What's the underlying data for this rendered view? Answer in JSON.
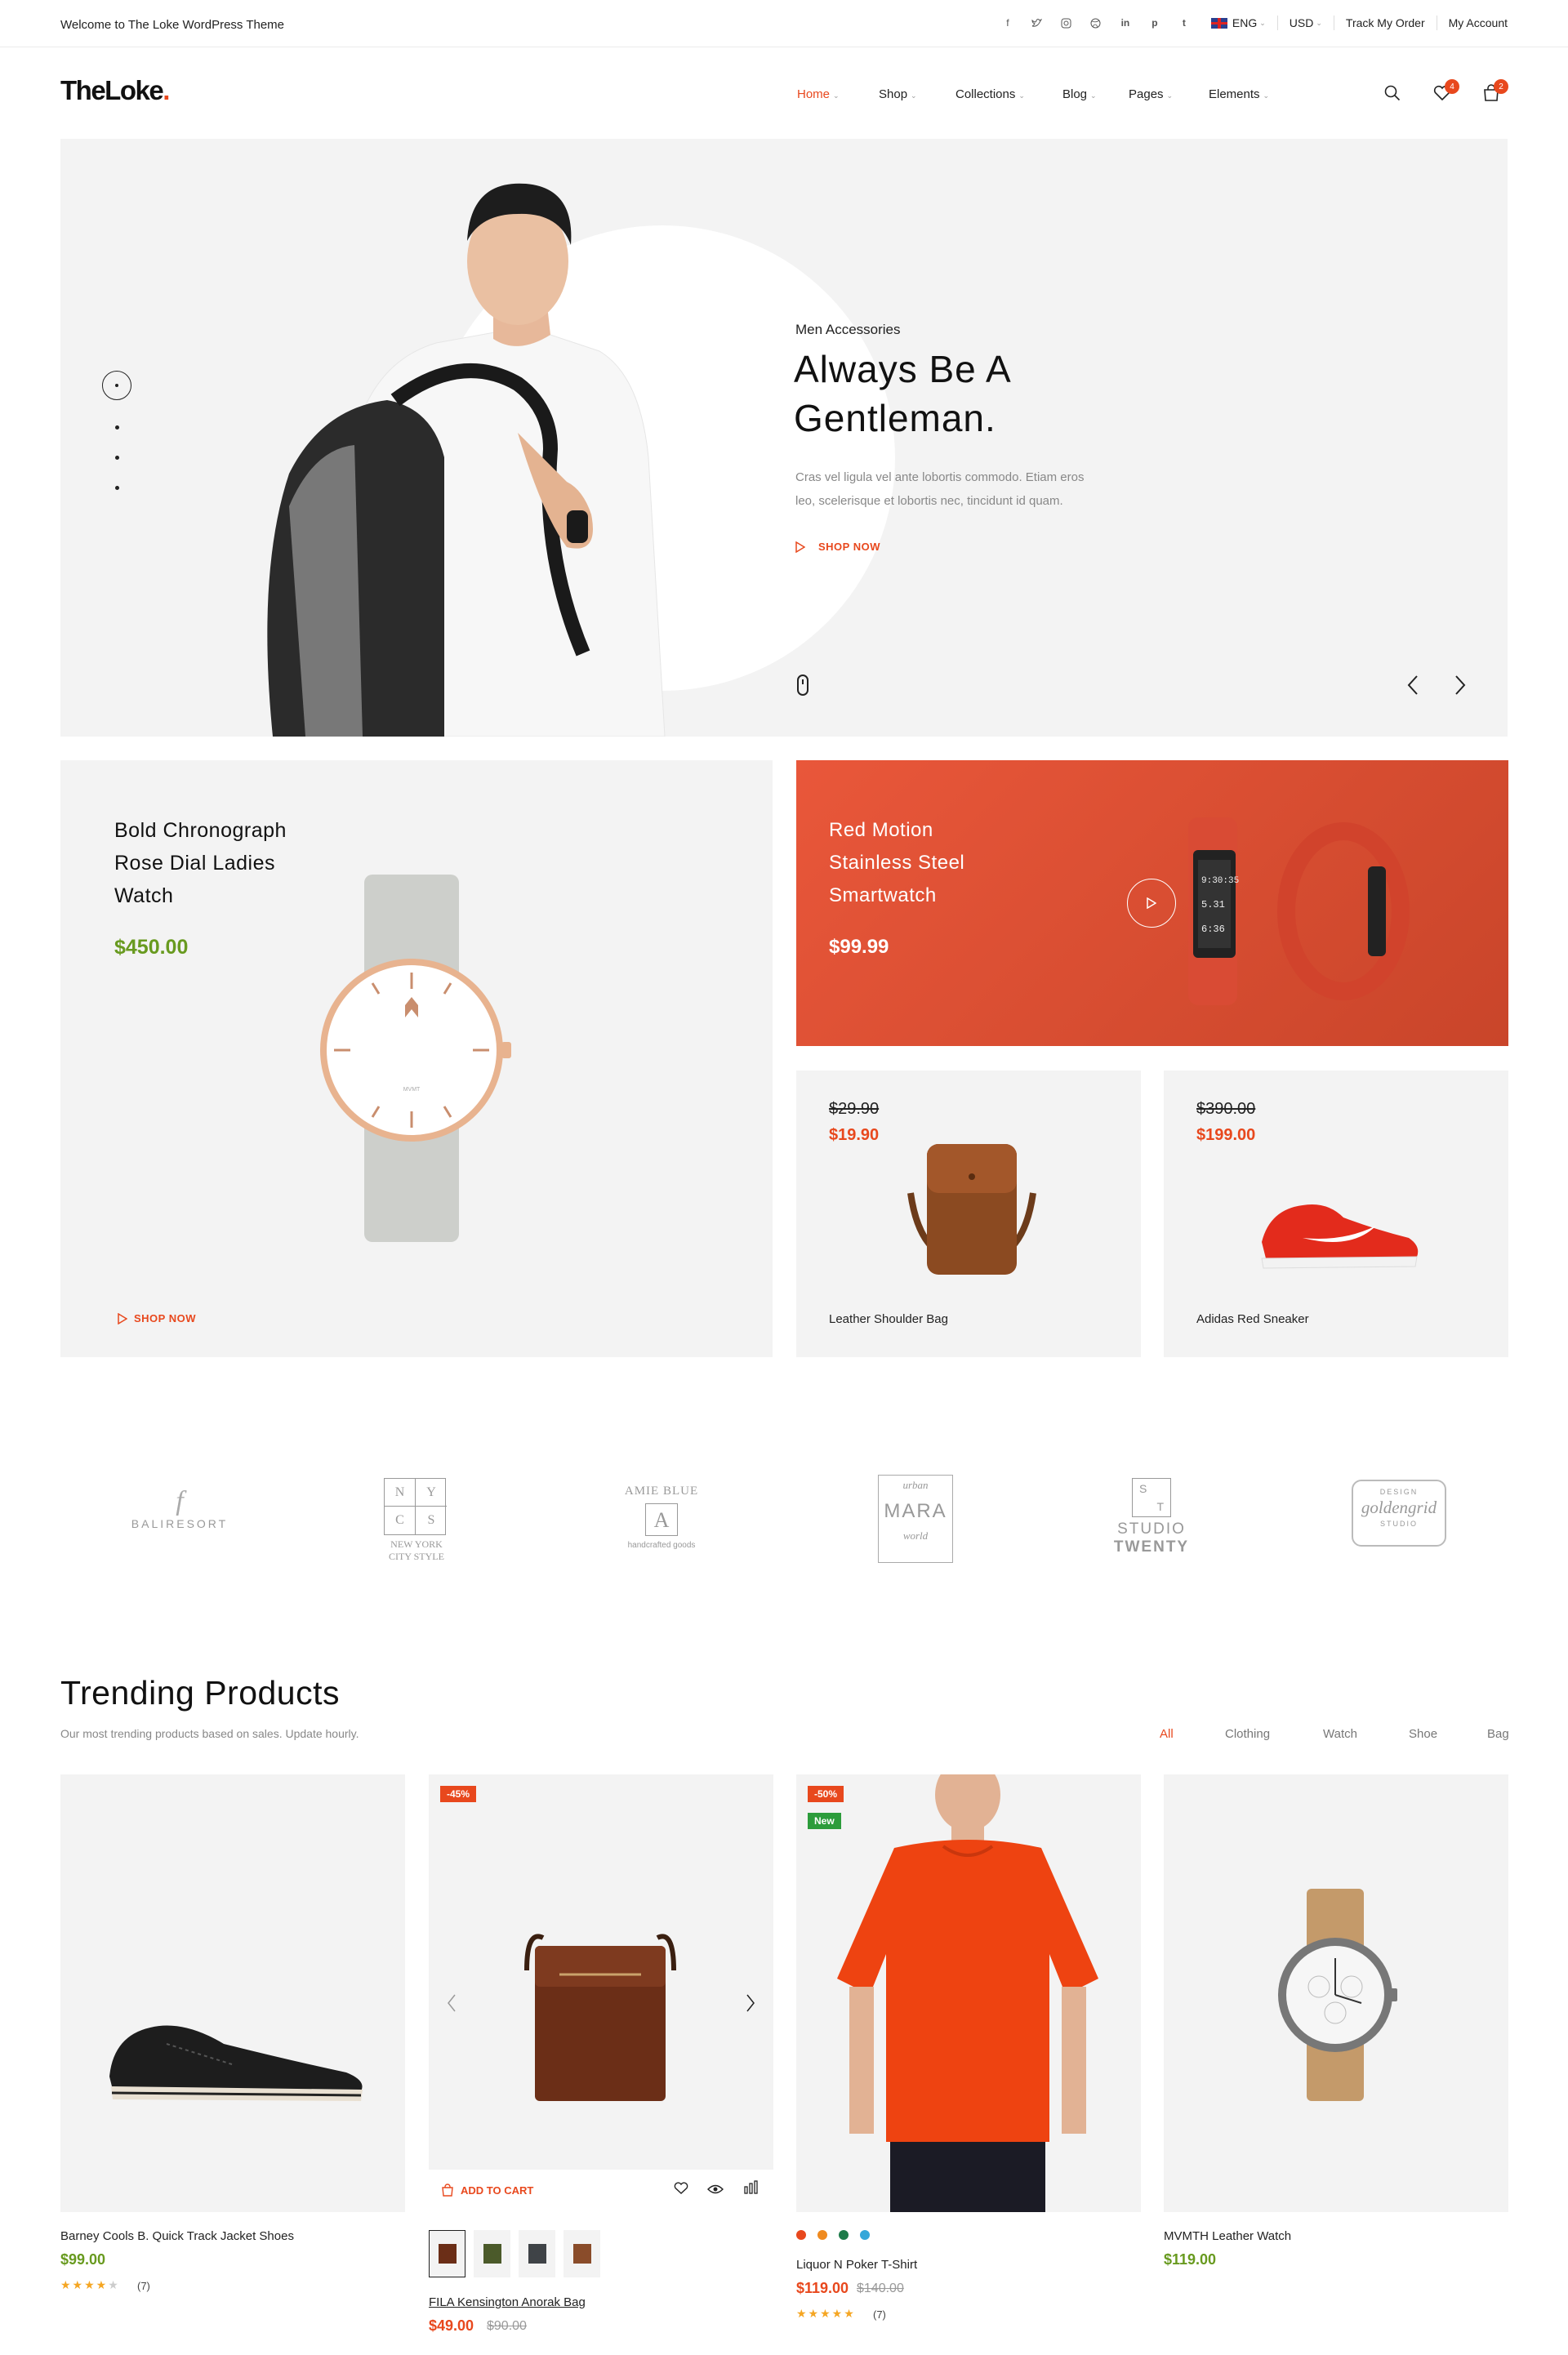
{
  "topbar": {
    "welcome": "Welcome to The Loke WordPress Theme",
    "language": "ENG",
    "currency": "USD",
    "track_order": "Track My Order",
    "account": "My Account"
  },
  "header": {
    "logo": "TheLoke",
    "logo_dot": ".",
    "nav": [
      "Home",
      "Shop",
      "Collections",
      "Blog",
      "Pages",
      "Elements"
    ],
    "wishlist_count": "4",
    "cart_count": "2"
  },
  "hero": {
    "subtitle": "Men Accessories",
    "title_line1": "Always Be A",
    "title_line2": "Gentleman.",
    "desc_line1": "Cras vel ligula vel ante lobortis commodo. Etiam eros",
    "desc_line2": "leo, scelerisque et lobortis nec, tincidunt id quam.",
    "cta": "SHOP NOW"
  },
  "promo_watch": {
    "line1": "Bold Chronograph",
    "line2": "Rose Dial Ladies",
    "line3": "Watch",
    "price": "$450.00",
    "cta": "SHOP NOW",
    "dial_label": "MVMT"
  },
  "promo_smartwatch": {
    "line1": "Red Motion",
    "line2": "Stainless Steel",
    "line3": "Smartwatch",
    "price": "$99.99",
    "screen_line1": "9:30:35",
    "screen_line2": "5.31",
    "screen_line3": "6:36"
  },
  "promo_bag": {
    "old_price": "$29.90",
    "price": "$19.90",
    "name": "Leather Shoulder Bag"
  },
  "promo_sneaker": {
    "old_price": "$390.00",
    "price": "$199.00",
    "name": "Adidas Red Sneaker"
  },
  "brands": {
    "baliresort": "BALIRESORT",
    "nycs_letters": [
      "N",
      "Y",
      "C",
      "S"
    ],
    "nycs_line1": "NEW YORK",
    "nycs_line2": "CITY STYLE",
    "amie_title": "AMIE BLUE",
    "amie_letter": "A",
    "amie_sub": "handcrafted goods",
    "mara_top": "urban",
    "mara_name": "MARA",
    "mara_bottom": "world",
    "studio_letters": [
      "S",
      "T"
    ],
    "studio_line1": "STUDIO",
    "studio_line2": "TWENTY",
    "golden_top": "DESIGN",
    "golden_name": "goldengrid",
    "golden_bottom": "STUDIO"
  },
  "trending": {
    "title": "Trending Products",
    "subtitle": "Our most trending products based on sales. Update hourly.",
    "filters": [
      "All",
      "Clothing",
      "Watch",
      "Shoe",
      "Bag"
    ],
    "products": [
      {
        "name": "Barney Cools B. Quick Track Jacket Shoes",
        "price": "$99.00",
        "reviews": "(7)"
      },
      {
        "name": "FILA Kensington Anorak Bag",
        "price": "$49.00",
        "old_price": "$90.00",
        "sale": "-45%",
        "add_to_cart": "ADD TO CART"
      },
      {
        "name": "Liquor N Poker T-Shirt",
        "price": "$119.00",
        "old_price": "$140.00",
        "sale": "-50%",
        "badge_new": "New",
        "reviews": "(7)"
      },
      {
        "name": "MVMTH Leather Watch",
        "price": "$119.00"
      }
    ],
    "colors": [
      "#e8481d",
      "#ef8a1f",
      "#1e7b4a",
      "#35a7d9"
    ]
  }
}
